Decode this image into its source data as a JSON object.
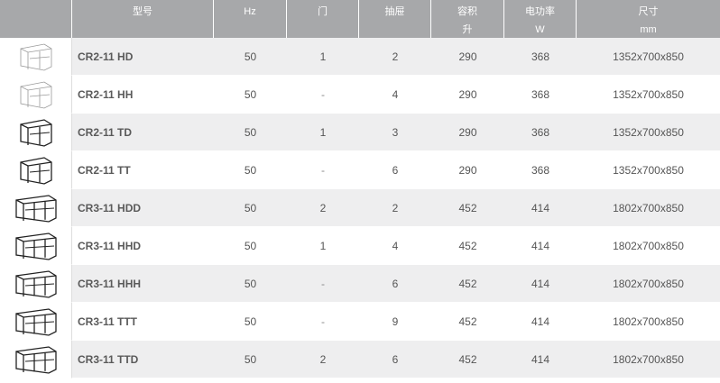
{
  "columns": [
    {
      "line1": "型号",
      "line2": ""
    },
    {
      "line1": "Hz",
      "line2": ""
    },
    {
      "line1": "门",
      "line2": ""
    },
    {
      "line1": "抽屉",
      "line2": ""
    },
    {
      "line1": "容积",
      "line2": "升"
    },
    {
      "line1": "电功率",
      "line2": "W"
    },
    {
      "line1": "尺寸",
      "line2": "mm"
    }
  ],
  "rows": [
    {
      "icon": "fridge-2-door-light-icon",
      "model": "CR2-11 HD",
      "hz": "50",
      "doors": "1",
      "drawers": "2",
      "volume": "290",
      "power": "368",
      "size": "1352x700x850"
    },
    {
      "icon": "fridge-2-drawer-light-icon",
      "model": "CR2-11 HH",
      "hz": "50",
      "doors": "-",
      "drawers": "4",
      "volume": "290",
      "power": "368",
      "size": "1352x700x850"
    },
    {
      "icon": "fridge-2-section-door-icon",
      "model": "CR2-11 TD",
      "hz": "50",
      "doors": "1",
      "drawers": "3",
      "volume": "290",
      "power": "368",
      "size": "1352x700x850"
    },
    {
      "icon": "fridge-2-section-drawer-icon",
      "model": "CR2-11 TT",
      "hz": "50",
      "doors": "-",
      "drawers": "6",
      "volume": "290",
      "power": "368",
      "size": "1352x700x850"
    },
    {
      "icon": "fridge-3-door-icon",
      "model": "CR3-11 HDD",
      "hz": "50",
      "doors": "2",
      "drawers": "2",
      "volume": "452",
      "power": "414",
      "size": "1802x700x850"
    },
    {
      "icon": "fridge-3-door-drawer-icon",
      "model": "CR3-11 HHD",
      "hz": "50",
      "doors": "1",
      "drawers": "4",
      "volume": "452",
      "power": "414",
      "size": "1802x700x850"
    },
    {
      "icon": "fridge-3-drawer-icon",
      "model": "CR3-11 HHH",
      "hz": "50",
      "doors": "-",
      "drawers": "6",
      "volume": "452",
      "power": "414",
      "size": "1802x700x850"
    },
    {
      "icon": "fridge-3-triple-drawer-icon",
      "model": "CR3-11 TTT",
      "hz": "50",
      "doors": "-",
      "drawers": "9",
      "volume": "452",
      "power": "414",
      "size": "1802x700x850"
    },
    {
      "icon": "fridge-3-triple-door-icon",
      "model": "CR3-11 TTD",
      "hz": "50",
      "doors": "2",
      "drawers": "6",
      "volume": "452",
      "power": "414",
      "size": "1802x700x850"
    }
  ],
  "colors": {
    "header_bg": "#a7a8aa",
    "stripe_bg": "#eeeeef",
    "text": "#555555"
  }
}
